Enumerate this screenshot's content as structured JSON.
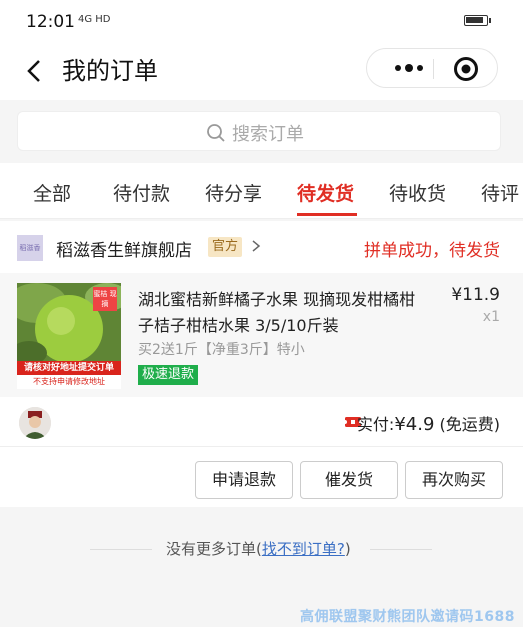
{
  "status_bar": {
    "time": "12:01",
    "network": "4G HD",
    "battery_level": 0.8
  },
  "navbar": {
    "back_icon": "chevron-left-icon",
    "title": "我的订单",
    "more_icon": "more-dots-icon",
    "target_icon": "target-icon"
  },
  "search": {
    "placeholder": "搜索订单",
    "icon": "search-icon"
  },
  "tabs": [
    {
      "label": "全部",
      "active": false
    },
    {
      "label": "待付款",
      "active": false
    },
    {
      "label": "待分享",
      "active": false
    },
    {
      "label": "待发货",
      "active": true
    },
    {
      "label": "待收货",
      "active": false
    },
    {
      "label": "待评",
      "active": false
    }
  ],
  "order": {
    "shop_logo_text": "稻滋香",
    "shop_name": "稻滋香生鲜旗舰店",
    "official_badge": "官方",
    "status": "拼单成功，待发货",
    "goods": {
      "image_tag": "蜜桔 现摘",
      "image_banner_1": "请核对好地址提交订单",
      "image_banner_2": "不支持申请修改地址",
      "title": "湖北蜜桔新鲜橘子水果 现摘现发柑橘柑子桔子柑桔水果 3/5/10斤装",
      "spec": "买2送1斤【净重3斤】特小",
      "fast_refund": "极速退款",
      "price": "¥11.9",
      "quantity": "x1"
    },
    "payment": {
      "label": "实付:",
      "amount": "¥4.9",
      "shipping": "(免运费)"
    },
    "actions": {
      "refund": "申请退款",
      "urge": "催发货",
      "rebuy": "再次购买"
    }
  },
  "footer": {
    "no_more": "没有更多订单(",
    "link": "找不到订单?",
    "close_paren": ")"
  },
  "watermark": "高佣联盟聚财熊团队邀请码1688",
  "colors": {
    "accent": "#e02e24",
    "refund_green": "#1fae4b",
    "link_blue": "#3b6fc4"
  }
}
